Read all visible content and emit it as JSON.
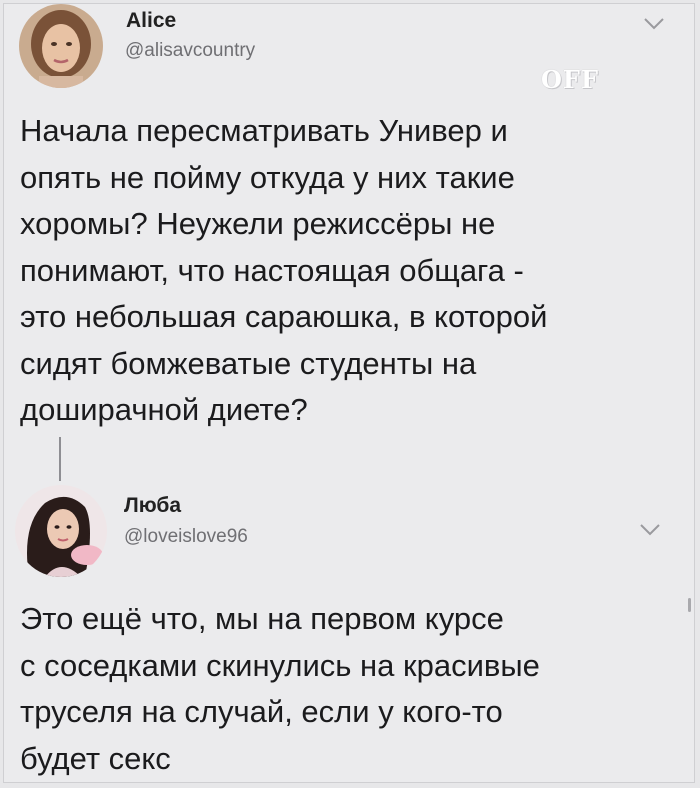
{
  "tweets": [
    {
      "name": "Alice",
      "handle": "@alisavcountry",
      "avatar_icon": "user-avatar-icon",
      "text": "Начала пересматривать Универ и\nопять не пойму откуда у них такие\nхоромы? Неужели режиссёры не\nпонимают, что настоящая общага -\nэто небольшая сараюшка, в которой\nсидят бомжеватые студенты на\nдоширачной диете?"
    },
    {
      "name": "Люба",
      "handle": "@loveislove96",
      "avatar_icon": "user-avatar-icon",
      "text": "Это ещё что, мы на первом курсе\nс соседками скинулись на красивые\nтруселя на случай, если у кого-то\nбудет секс"
    }
  ],
  "watermark": "OFF",
  "colors": {
    "background": "#ebebed",
    "handle": "#6f6f73",
    "text": "#1b1b1d"
  }
}
